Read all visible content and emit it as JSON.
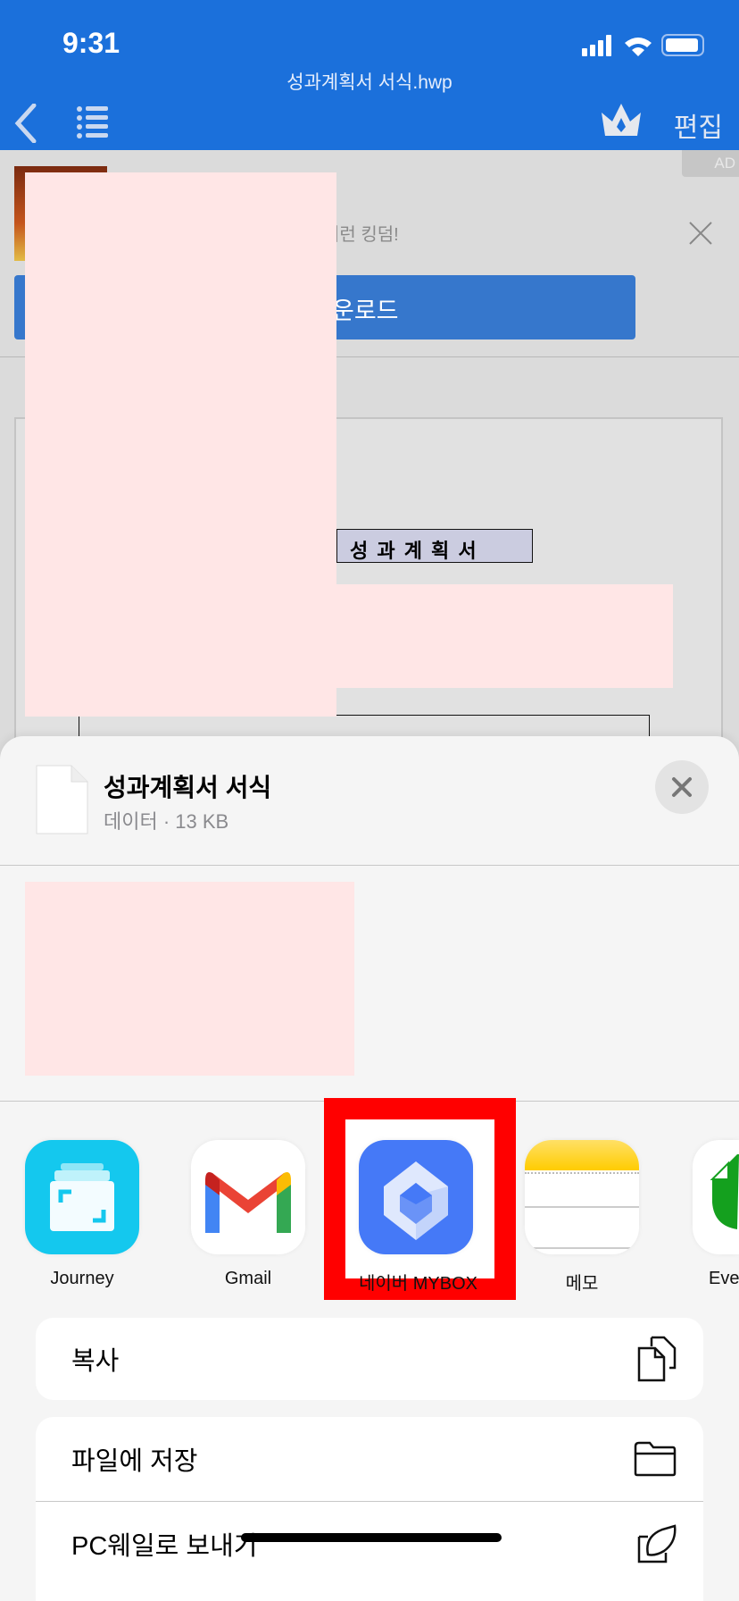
{
  "status": {
    "time": "9:31"
  },
  "header": {
    "title": "성과계획서 서식.hwp",
    "edit_label": "편집",
    "accent": "#1b70db"
  },
  "ad": {
    "badge": "AD",
    "text": "키런 킹덤!",
    "button_label": "운로드"
  },
  "document": {
    "heading": "성 과 계 획 서"
  },
  "share_sheet": {
    "file_name": "성과계획서 서식",
    "file_meta": "데이터 · 13 KB",
    "apps": [
      {
        "label": "Journey"
      },
      {
        "label": "Gmail"
      },
      {
        "label": "네이버 MYBOX"
      },
      {
        "label": "메모"
      },
      {
        "label": "Eve"
      }
    ],
    "highlight_color": "#ff0000",
    "actions": [
      {
        "label": "복사",
        "icon": "copy-icon"
      },
      {
        "label": "파일에 저장",
        "icon": "folder-icon"
      },
      {
        "label": "PC웨일로 보내기",
        "icon": "whale-icon"
      }
    ]
  }
}
